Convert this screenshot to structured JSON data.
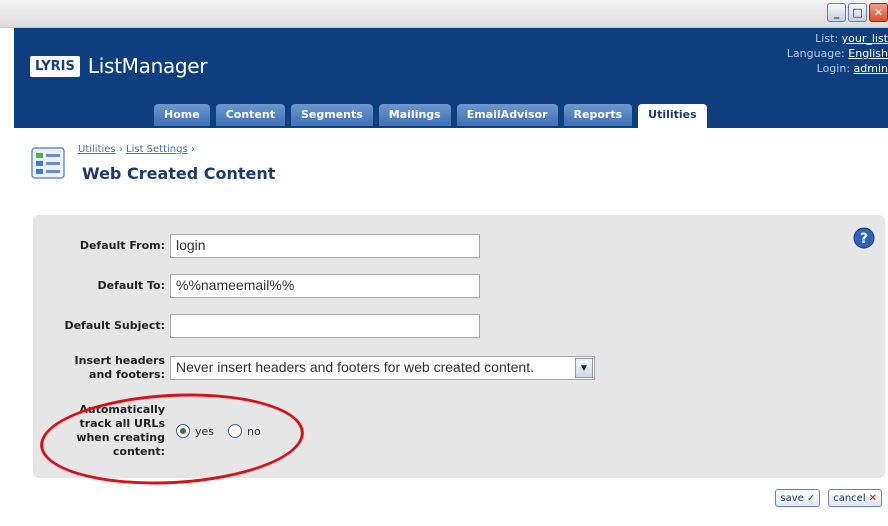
{
  "app": {
    "logo_badge": "LYRIS",
    "name": "ListManager"
  },
  "window_controls": {
    "minimize": "_",
    "maximize": "□",
    "close": "✕"
  },
  "userinfo": {
    "list_label": "List:",
    "list_value": "your_list",
    "language_label": "Language:",
    "language_value": "English",
    "login_label": "Login:",
    "login_value": "admin"
  },
  "tabs": [
    {
      "label": "Home"
    },
    {
      "label": "Content"
    },
    {
      "label": "Segments"
    },
    {
      "label": "Mailings"
    },
    {
      "label": "EmailAdvisor"
    },
    {
      "label": "Reports"
    },
    {
      "label": "Utilities"
    }
  ],
  "breadcrumb": {
    "item1": "Utilities",
    "sep": "›",
    "item2": "List Settings",
    "trail": "›"
  },
  "page_title": "Web Created Content",
  "form": {
    "default_from": {
      "label": "Default From:",
      "value": "login"
    },
    "default_to": {
      "label": "Default To:",
      "value": "%%nameemail%%"
    },
    "default_subject": {
      "label": "Default Subject:",
      "value": ""
    },
    "insert_headers": {
      "label_line1": "Insert headers",
      "label_line2": "and footers:",
      "selected": "Never insert headers and footers for web created content."
    },
    "track_urls": {
      "label_line1": "Automatically",
      "label_line2": "track all URLs",
      "label_line3": "when creating",
      "label_line4": "content:",
      "yes_label": "yes",
      "no_label": "no",
      "selected": "yes"
    }
  },
  "actions": {
    "save": "save",
    "cancel": "cancel"
  },
  "colors": {
    "header_bg": "#0e3e7e",
    "annotation": "#d8101a",
    "panel_bg": "#e6e6e6"
  }
}
